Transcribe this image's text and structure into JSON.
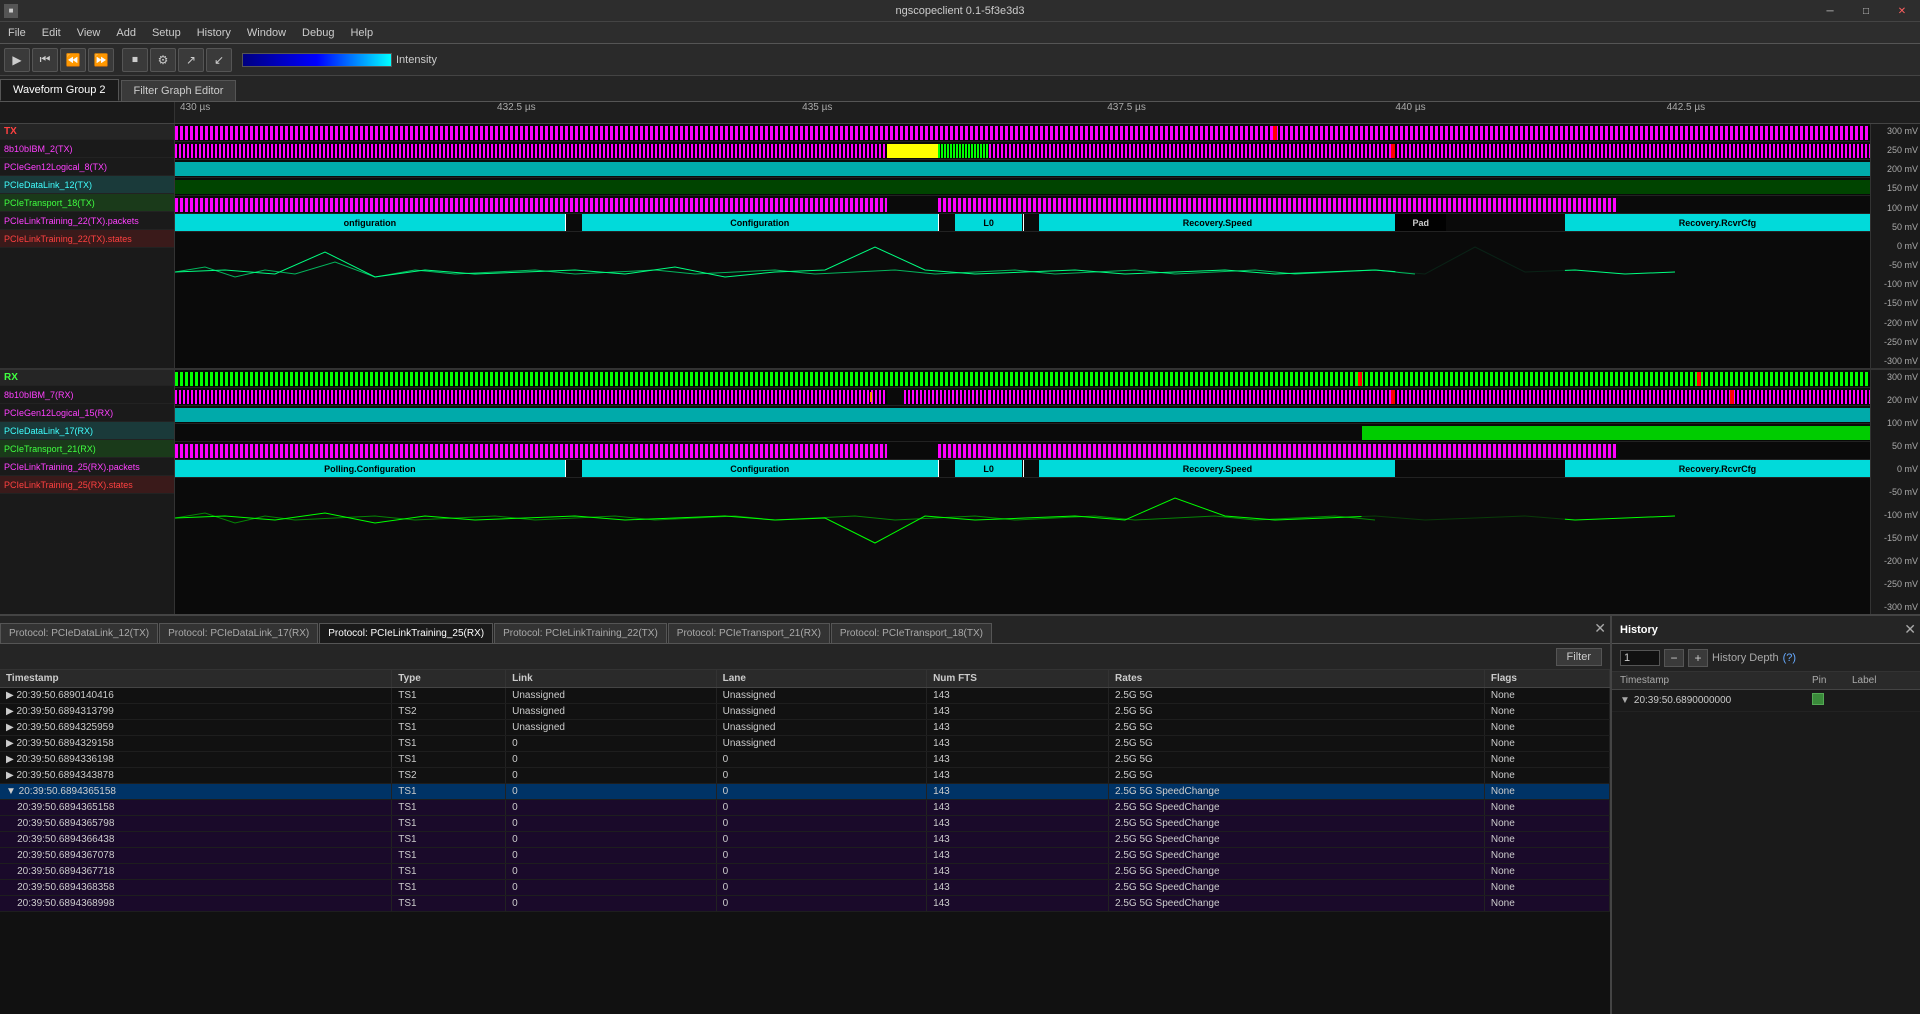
{
  "app": {
    "title": "ngscopeclient 0.1-5f3e3d3"
  },
  "titlebar": {
    "minimize": "─",
    "maximize": "□",
    "close": "✕",
    "icon": "■"
  },
  "menubar": {
    "items": [
      "File",
      "Edit",
      "View",
      "Add",
      "Setup",
      "History",
      "Window",
      "Debug",
      "Help"
    ]
  },
  "toolbar": {
    "intensity_label": "Intensity",
    "intensity_value": "50"
  },
  "tabs": {
    "waveform": "Waveform Group 2",
    "filter_graph": "Filter Graph Editor"
  },
  "time_ruler": {
    "marks": [
      "430 µs",
      "432.5 µs",
      "435 µs",
      "437.5 µs",
      "440 µs",
      "442.5 µs"
    ]
  },
  "tx_channels": [
    {
      "name": "TX",
      "type": "header",
      "color": "tx"
    },
    {
      "name": "8b10bIBM_2(TX)",
      "color": "magenta"
    },
    {
      "name": "PCIeGen12Logical_8(TX)",
      "color": "magenta"
    },
    {
      "name": "PCIeDataLink_12(TX)",
      "color": "cyan"
    },
    {
      "name": "PCIeTransport_18(TX)",
      "color": "green"
    },
    {
      "name": "PCIeLinkTraining_22(TX).packets",
      "color": "magenta"
    },
    {
      "name": "PCIeLinkTraining_22(TX).states",
      "color": "red"
    }
  ],
  "rx_channels": [
    {
      "name": "RX",
      "type": "header",
      "color": "rx"
    },
    {
      "name": "8b10bIBM_7(RX)",
      "color": "magenta"
    },
    {
      "name": "PCIeGen12Logical_15(RX)",
      "color": "magenta"
    },
    {
      "name": "PCIeDataLink_17(RX)",
      "color": "cyan"
    },
    {
      "name": "PCIeTransport_21(RX)",
      "color": "green"
    },
    {
      "name": "PCIeLinkTraining_25(RX).packets",
      "color": "magenta"
    },
    {
      "name": "PCIeLinkTraining_25(RX).states",
      "color": "red"
    }
  ],
  "tx_states": [
    {
      "label": "onfiguration",
      "left": "0%",
      "width": "23%",
      "color": "cyan"
    },
    {
      "label": "Configuration",
      "left": "23%",
      "width": "22%",
      "color": "cyan"
    },
    {
      "label": "L0",
      "left": "45%",
      "width": "5%",
      "color": "cyan"
    },
    {
      "label": "Recovery.Speed",
      "left": "50%",
      "width": "22%",
      "color": "cyan"
    },
    {
      "label": "Pad",
      "left": "72.5%",
      "width": "3%",
      "color": "black"
    },
    {
      "label": "Recovery.RcvrCfg",
      "left": "82%",
      "width": "18%",
      "color": "cyan"
    }
  ],
  "rx_states": [
    {
      "label": "Polling.Configuration",
      "left": "0%",
      "width": "23%",
      "color": "cyan"
    },
    {
      "label": "Configuration",
      "left": "23%",
      "width": "22%",
      "color": "cyan"
    },
    {
      "label": "L0",
      "left": "45%",
      "width": "5%",
      "color": "cyan"
    },
    {
      "label": "Recovery.Speed",
      "left": "50%",
      "width": "22%",
      "color": "cyan"
    },
    {
      "label": "Recovery.RcvrCfg",
      "left": "82%",
      "width": "18%",
      "color": "cyan"
    }
  ],
  "voltage_scale_tx": [
    "300 mV",
    "250 mV",
    "200 mV",
    "150 mV",
    "100 mV",
    "50 mV",
    "0 mV",
    "-50 mV",
    "-100 mV",
    "-150 mV",
    "-200 mV",
    "-250 mV",
    "-300 mV"
  ],
  "voltage_scale_rx": [
    "300 mV",
    "200 mV",
    "100 mV",
    "50 mV",
    "0 mV",
    "-50 mV",
    "-100 mV",
    "-150 mV",
    "-200 mV",
    "-250 mV",
    "-300 mV"
  ],
  "protocol_tabs": [
    {
      "label": "Protocol: PCIeDataLink_12(TX)",
      "active": false
    },
    {
      "label": "Protocol: PCIeDataLink_17(RX)",
      "active": false
    },
    {
      "label": "Protocol: PCIeLinkTraining_25(RX)",
      "active": true
    },
    {
      "label": "Protocol: PCIeLinkTraining_22(TX)",
      "active": false
    },
    {
      "label": "Protocol: PCIeTransport_21(RX)",
      "active": false
    },
    {
      "label": "Protocol: PCIeTransport_18(TX)",
      "active": false
    }
  ],
  "filter_button": "Filter",
  "table_headers": [
    "Timestamp",
    "Type",
    "Link",
    "Lane",
    "Num FTS",
    "Rates",
    "Flags"
  ],
  "table_rows": [
    {
      "expand": false,
      "timestamp": "20:39:50.6890140416",
      "type": "TS1",
      "link": "Unassigned",
      "lane": "Unassigned",
      "num_fts": "143",
      "rates": "2.5G 5G",
      "flags": "None",
      "selected": false
    },
    {
      "expand": false,
      "timestamp": "20:39:50.6894313799",
      "type": "TS2",
      "link": "Unassigned",
      "lane": "Unassigned",
      "num_fts": "143",
      "rates": "2.5G 5G",
      "flags": "None",
      "selected": false
    },
    {
      "expand": false,
      "timestamp": "20:39:50.6894325959",
      "type": "TS1",
      "link": "Unassigned",
      "lane": "Unassigned",
      "num_fts": "143",
      "rates": "2.5G 5G",
      "flags": "None",
      "selected": false
    },
    {
      "expand": false,
      "timestamp": "20:39:50.6894329158",
      "type": "TS1",
      "link": "0",
      "lane": "Unassigned",
      "num_fts": "143",
      "rates": "2.5G 5G",
      "flags": "None",
      "selected": false
    },
    {
      "expand": false,
      "timestamp": "20:39:50.6894336198",
      "type": "TS1",
      "link": "0",
      "lane": "0",
      "num_fts": "143",
      "rates": "2.5G 5G",
      "flags": "None",
      "selected": false
    },
    {
      "expand": false,
      "timestamp": "20:39:50.6894343878",
      "type": "TS2",
      "link": "0",
      "lane": "0",
      "num_fts": "143",
      "rates": "2.5G 5G",
      "flags": "None",
      "selected": false
    },
    {
      "expand": true,
      "timestamp": "20:39:50.6894365158",
      "type": "TS1",
      "link": "0",
      "lane": "0",
      "num_fts": "143",
      "rates": "2.5G 5G SpeedChange",
      "flags": "None",
      "selected": true
    },
    {
      "expand": false,
      "timestamp": "20:39:50.6894365158",
      "type": "TS1",
      "link": "0",
      "lane": "0",
      "num_fts": "143",
      "rates": "2.5G 5G SpeedChange",
      "flags": "None",
      "selected": false,
      "child": true
    },
    {
      "expand": false,
      "timestamp": "20:39:50.6894365798",
      "type": "TS1",
      "link": "0",
      "lane": "0",
      "num_fts": "143",
      "rates": "2.5G 5G SpeedChange",
      "flags": "None",
      "selected": false,
      "child": true
    },
    {
      "expand": false,
      "timestamp": "20:39:50.6894366438",
      "type": "TS1",
      "link": "0",
      "lane": "0",
      "num_fts": "143",
      "rates": "2.5G 5G SpeedChange",
      "flags": "None",
      "selected": false,
      "child": true
    },
    {
      "expand": false,
      "timestamp": "20:39:50.6894367078",
      "type": "TS1",
      "link": "0",
      "lane": "0",
      "num_fts": "143",
      "rates": "2.5G 5G SpeedChange",
      "flags": "None",
      "selected": false,
      "child": true
    },
    {
      "expand": false,
      "timestamp": "20:39:50.6894367718",
      "type": "TS1",
      "link": "0",
      "lane": "0",
      "num_fts": "143",
      "rates": "2.5G 5G SpeedChange",
      "flags": "None",
      "selected": false,
      "child": true
    },
    {
      "expand": false,
      "timestamp": "20:39:50.6894368358",
      "type": "TS1",
      "link": "0",
      "lane": "0",
      "num_fts": "143",
      "rates": "2.5G 5G SpeedChange",
      "flags": "None",
      "selected": false,
      "child": true
    },
    {
      "expand": false,
      "timestamp": "20:39:50.6894368998",
      "type": "TS1",
      "link": "0",
      "lane": "0",
      "num_fts": "143",
      "rates": "2.5G 5G SpeedChange",
      "flags": "None",
      "selected": false,
      "child": true
    }
  ],
  "history": {
    "title": "History",
    "depth_label": "History Depth",
    "depth_value": "1",
    "depth_question": "(?)",
    "col_timestamp": "Timestamp",
    "col_pin": "Pin",
    "col_label": "Label",
    "entry_timestamp": "20:39:50.6890000000",
    "add_btn": "+",
    "remove_btn": "-"
  }
}
